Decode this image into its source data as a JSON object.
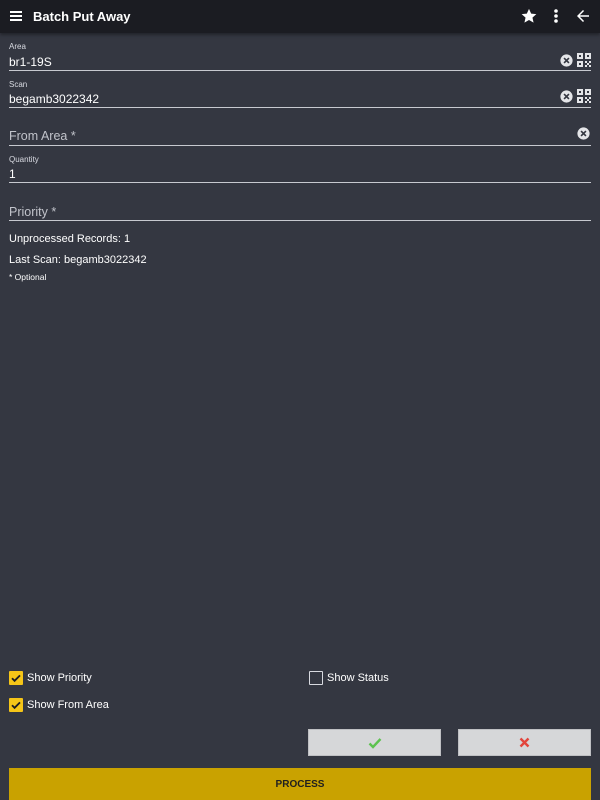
{
  "app": {
    "title": "Batch Put Away",
    "icons": {
      "menu": "hamburger-menu-icon",
      "favorite": "star-icon",
      "more": "more-vert-icon",
      "back": "arrow-back-icon"
    }
  },
  "form": {
    "area": {
      "label": "Area",
      "value": "br1-19S"
    },
    "scan": {
      "label": "Scan",
      "value": "begamb3022342"
    },
    "from_area": {
      "label": "From Area *",
      "value": ""
    },
    "quantity": {
      "label": "Quantity",
      "value": "1"
    },
    "priority": {
      "label": "Priority *",
      "value": ""
    }
  },
  "info": {
    "unprocessed": "Unprocessed Records: 1",
    "last_scan": "Last Scan: begamb3022342",
    "optional_note": "* Optional"
  },
  "options": {
    "show_priority": {
      "label": "Show Priority",
      "checked": true
    },
    "show_status": {
      "label": "Show Status",
      "checked": false
    },
    "show_from_area": {
      "label": "Show From Area",
      "checked": true
    }
  },
  "actions": {
    "process_label": "PROCESS",
    "confirm_icon": "checkmark-icon",
    "cancel_icon": "x-icon"
  },
  "colors": {
    "background": "#343741",
    "appbar": "#1b1c22",
    "accent_yellow": "#f5c518",
    "process_button": "#c9a200",
    "confirm_green": "#5cc24f",
    "cancel_red": "#e2453c"
  }
}
